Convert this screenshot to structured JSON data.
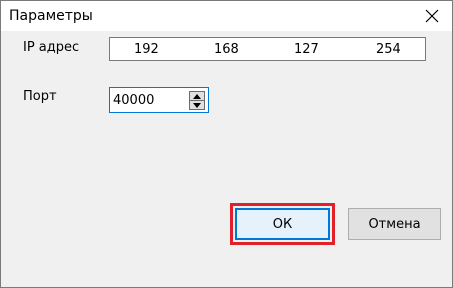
{
  "window": {
    "title": "Параметры",
    "close_icon": "close-icon"
  },
  "form": {
    "ip_label": "IP адрес",
    "ip_octets": [
      "192",
      "168",
      "127",
      "254"
    ],
    "port_label": "Порт",
    "port_value": "40000",
    "spin_up_icon": "triangle-up-icon",
    "spin_down_icon": "triangle-down-icon"
  },
  "buttons": {
    "ok_label": "ОК",
    "cancel_label": "Отмена"
  },
  "colors": {
    "highlight": "#e0202a",
    "focus_accent": "#0078d7"
  }
}
